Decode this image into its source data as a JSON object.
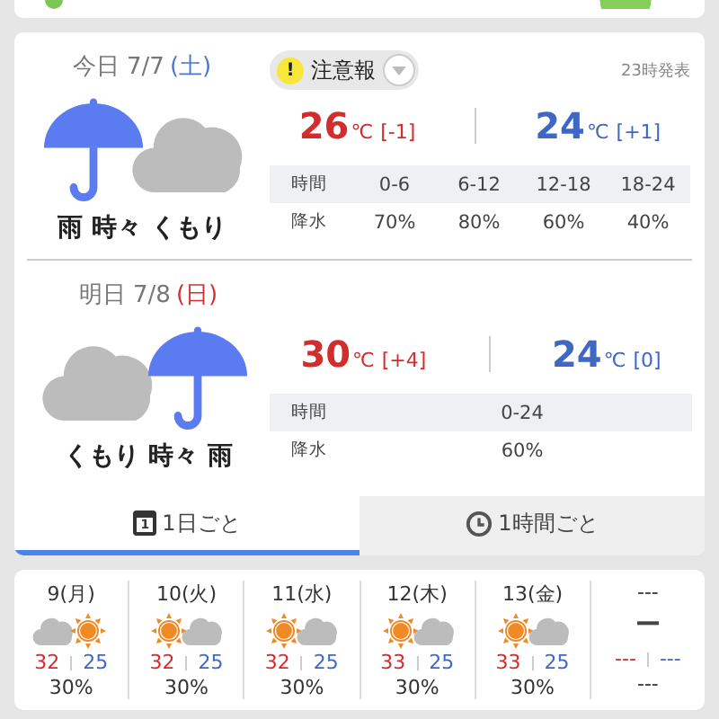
{
  "days": [
    {
      "date": "今日 7/7",
      "weekday": {
        "text": "(土)",
        "color": "#4a78d4"
      },
      "kind": "rain-cloud",
      "weather": "雨 時々 くもり",
      "warning": {
        "mark": "!",
        "label": "注意報"
      },
      "issued": "23時発表",
      "high": {
        "temp": "26",
        "unit": "℃",
        "diff": "[-1]"
      },
      "low": {
        "temp": "24",
        "unit": "℃",
        "diff": "[+1]"
      },
      "table": {
        "header": "時間",
        "periods": [
          "0-6",
          "6-12",
          "12-18",
          "18-24"
        ],
        "precip_label": "降水",
        "precip": [
          "70%",
          "80%",
          "60%",
          "40%"
        ]
      }
    },
    {
      "date": "明日 7/8",
      "weekday": {
        "text": "(日)",
        "color": "#d43030"
      },
      "kind": "cloud-rain",
      "weather": "くもり 時々 雨",
      "high": {
        "temp": "30",
        "unit": "℃",
        "diff": "[+4]"
      },
      "low": {
        "temp": "24",
        "unit": "℃",
        "diff": "[0]"
      },
      "table": {
        "header": "時間",
        "periods": [
          "0-24"
        ],
        "precip_label": "降水",
        "precip": [
          "60%"
        ]
      }
    }
  ],
  "tabs": [
    {
      "kind": "calendar",
      "icon_label": "1",
      "label": "1日ごと",
      "selected": true
    },
    {
      "kind": "clock",
      "label": "1時間ごと",
      "selected": false
    }
  ],
  "week": [
    {
      "date": "9(月)",
      "kind": "cloud-sun",
      "high": "32",
      "low": "25",
      "precip": "30%"
    },
    {
      "date": "10(火)",
      "kind": "sun-cloud",
      "high": "32",
      "low": "25",
      "precip": "30%"
    },
    {
      "date": "11(水)",
      "kind": "sun-cloud",
      "high": "32",
      "low": "25",
      "precip": "30%"
    },
    {
      "date": "12(木)",
      "kind": "sun-cloud",
      "high": "33",
      "low": "25",
      "precip": "30%"
    },
    {
      "date": "13(金)",
      "kind": "sun-cloud",
      "high": "33",
      "low": "25",
      "precip": "30%"
    },
    {
      "date": "---",
      "kind": "none",
      "weather": "ー",
      "high": "---",
      "low": "---",
      "precip": "---"
    }
  ]
}
